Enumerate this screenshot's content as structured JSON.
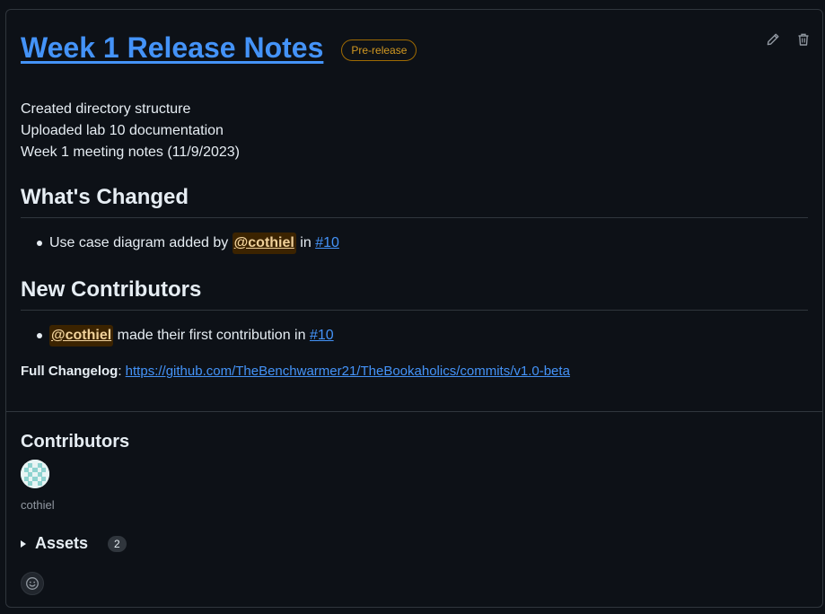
{
  "release": {
    "title": "Week 1 Release Notes",
    "badge": "Pre-release",
    "edit_icon": "pencil-icon",
    "delete_icon": "trash-icon"
  },
  "body": {
    "lines": [
      "Created directory structure",
      "Uploaded lab 10 documentation",
      "Week 1 meeting notes (11/9/2023)"
    ]
  },
  "whats_changed": {
    "heading": "What's Changed",
    "item": {
      "text_before": "Use case diagram added by ",
      "mention": "@cothiel",
      "text_mid": " in ",
      "pr_link": "#10"
    }
  },
  "new_contributors": {
    "heading": "New Contributors",
    "item": {
      "mention": "@cothiel",
      "text_mid": " made their first contribution in ",
      "pr_link": "#10"
    }
  },
  "changelog": {
    "label": "Full Changelog",
    "separator": ": ",
    "url": "https://github.com/TheBenchwarmer21/TheBookaholics/commits/v1.0-beta"
  },
  "contributors": {
    "heading": "Contributors",
    "users": [
      {
        "name": "cothiel"
      }
    ]
  },
  "assets": {
    "label": "Assets",
    "count": "2"
  },
  "reactions": {
    "icon": "smiley-icon"
  },
  "colors": {
    "background": "#0d1117",
    "border": "#30363d",
    "link": "#4493f8",
    "badge_warning": "#d29922",
    "mention_bg": "#3b2300"
  }
}
